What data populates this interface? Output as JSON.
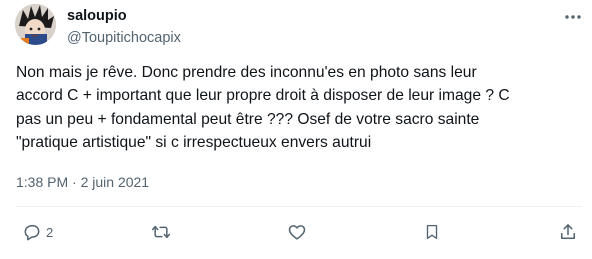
{
  "author": {
    "display_name": "saloupio",
    "handle": "@Toupitichocapix"
  },
  "tweet": {
    "lines": [
      "Non mais je rêve. Donc prendre des inconnu'es en photo sans leur",
      "accord C + important que leur propre droit à disposer de leur image ? C",
      "pas un peu + fondamental peut être ??? Osef de votre sacro sainte",
      "\"pratique artistique\" si c irrespectueux envers autrui"
    ],
    "timestamp": "1:38 PM · 2 juin 2021"
  },
  "actions": {
    "reply": {
      "icon": "reply-icon",
      "count": "2"
    },
    "retweet": {
      "icon": "retweet-icon",
      "count": ""
    },
    "like": {
      "icon": "heart-icon",
      "count": ""
    },
    "bookmark": {
      "icon": "bookmark-icon",
      "count": ""
    },
    "share": {
      "icon": "share-icon",
      "count": ""
    }
  },
  "colors": {
    "text": "#0f1419",
    "secondary": "#536471",
    "divider": "#eff3f4"
  }
}
